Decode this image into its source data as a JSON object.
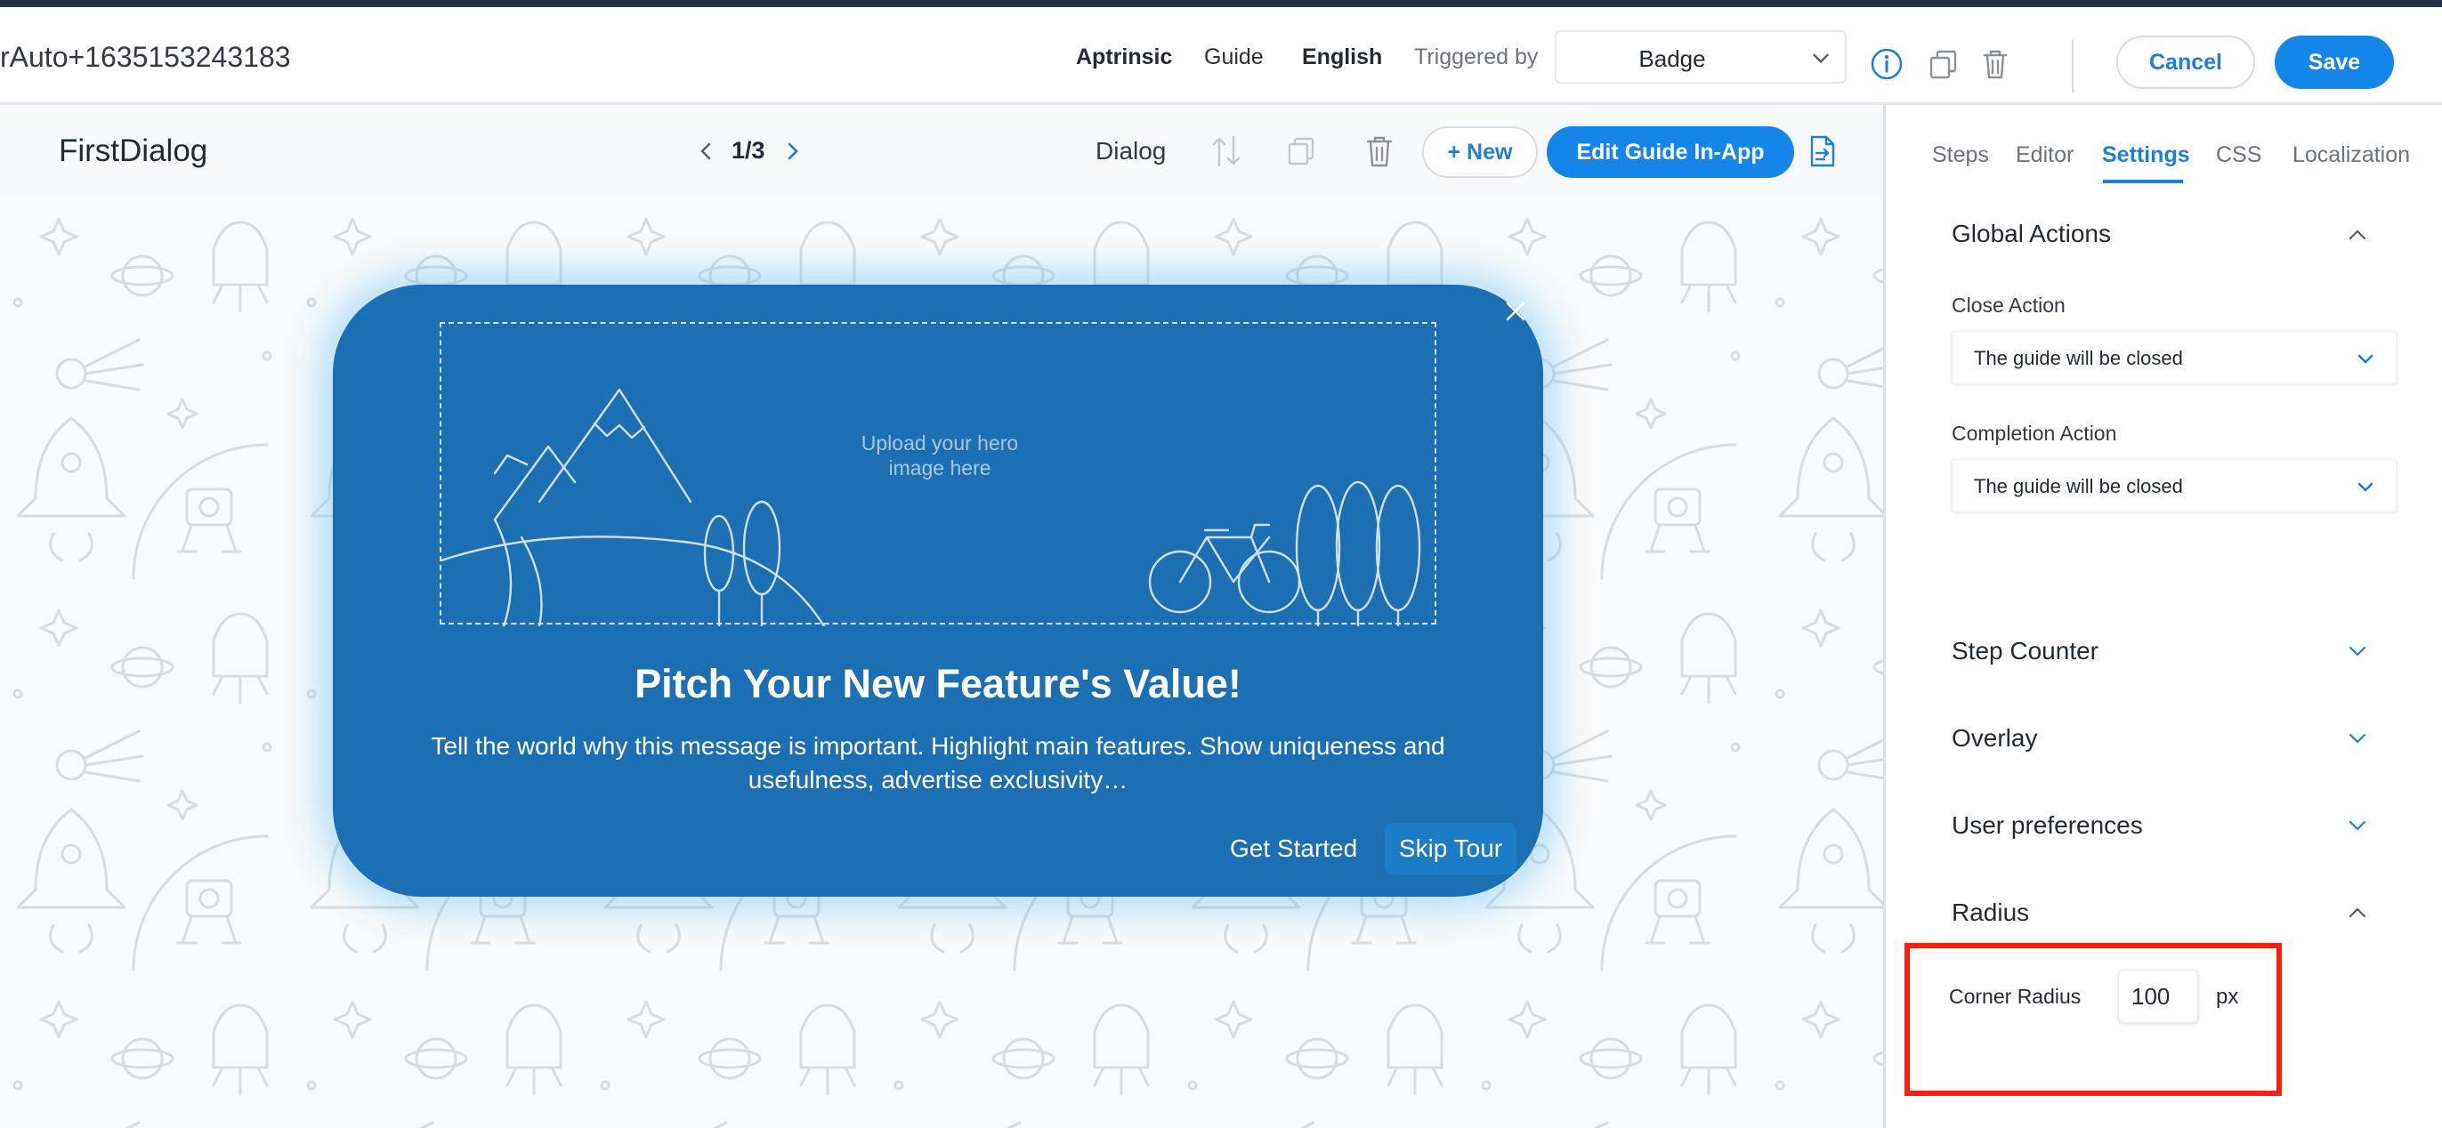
{
  "header": {
    "guide_name": "rAuto+1635153243183",
    "links": [
      "Aptrinsic",
      "Guide",
      "English"
    ],
    "triggered_by_label": "Triggered by",
    "triggered_by_value": "Badge",
    "cancel_label": "Cancel",
    "save_label": "Save",
    "icons": [
      "info-icon",
      "copy-icon",
      "trash-icon"
    ]
  },
  "toolbar": {
    "step_name": "FirstDialog",
    "pager": "1/3",
    "step_type": "Dialog",
    "new_label": "+ New",
    "edit_label": "Edit Guide In-App",
    "icons": [
      "reorder-icon",
      "duplicate-icon",
      "trash-icon",
      "export-icon"
    ]
  },
  "dialog": {
    "hero_placeholder_line1": "Upload your hero",
    "hero_placeholder_line2": "image here",
    "title": "Pitch Your New Feature's Value!",
    "body": "Tell the world why this message is important. Highlight main features. Show uniqueness and usefulness, advertise exclusivity…",
    "primary_button": "Get Started",
    "secondary_button": "Skip Tour",
    "bg_color": "#1b6fb2"
  },
  "panel": {
    "tabs": [
      "Steps",
      "Editor",
      "Settings",
      "CSS",
      "Localization"
    ],
    "active_tab": "Settings",
    "global_actions": {
      "title": "Global Actions",
      "close_action_label": "Close Action",
      "close_action_value": "The guide will be closed",
      "completion_action_label": "Completion Action",
      "completion_action_value": "The guide will be closed"
    },
    "sections": [
      "Step Counter",
      "Overlay",
      "User preferences"
    ],
    "radius": {
      "title": "Radius",
      "label": "Corner Radius",
      "value": "100",
      "unit": "px"
    }
  },
  "colors": {
    "accent": "#1585ea",
    "highlight": "#ff1f10"
  }
}
